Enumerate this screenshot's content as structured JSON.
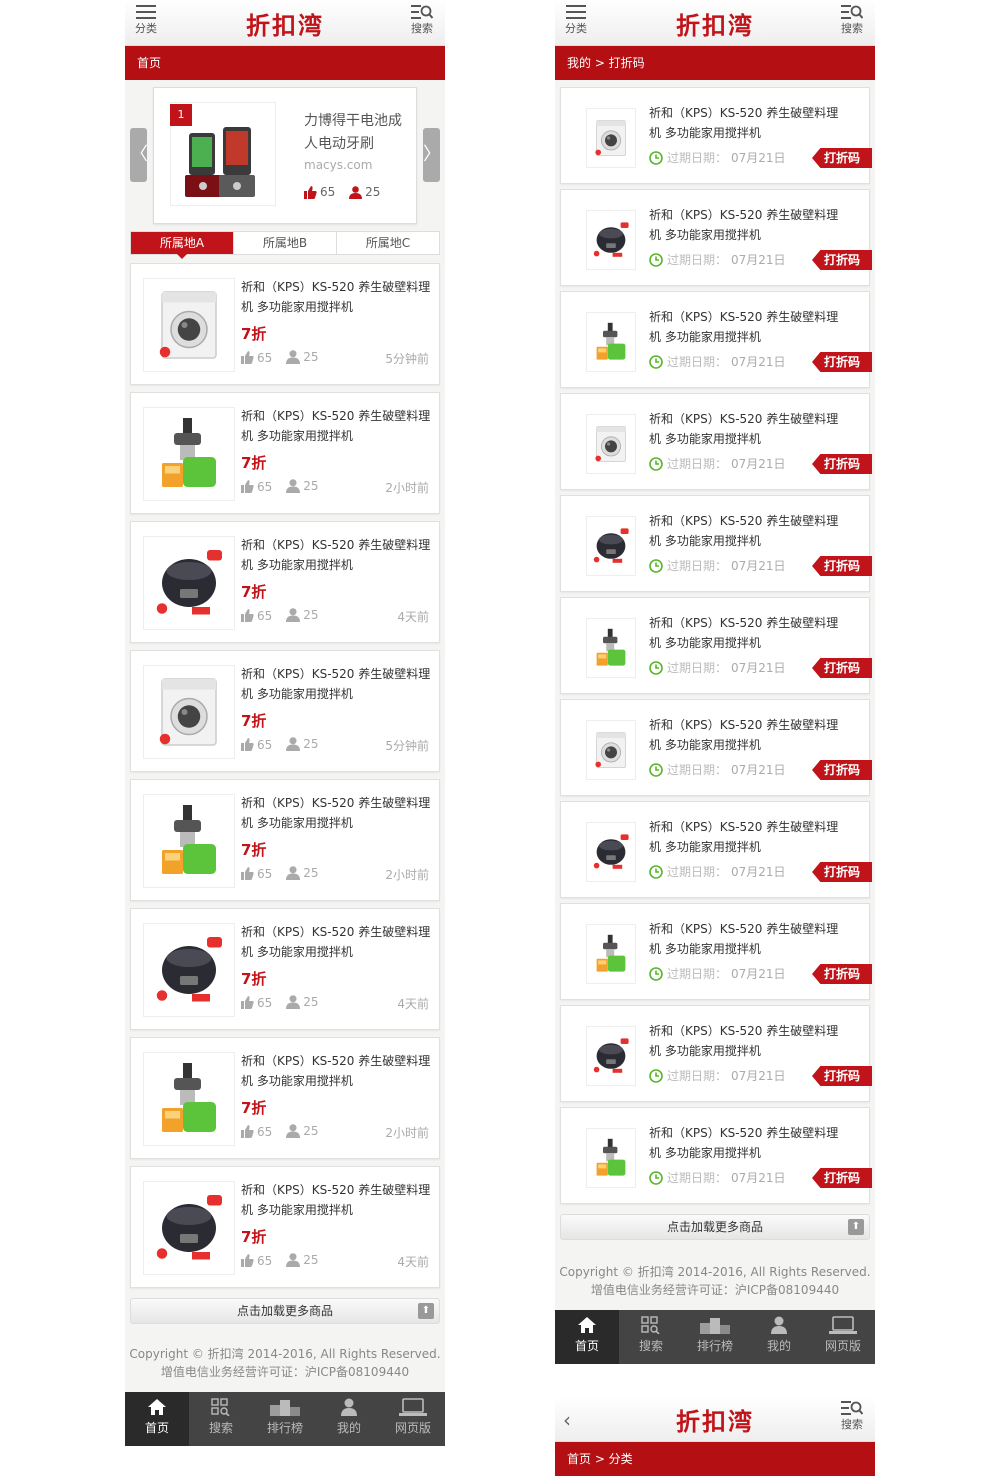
{
  "brand": "折扣湾",
  "topbar": {
    "menu_label": "分类",
    "search_label": "搜索"
  },
  "screen1": {
    "breadcrumb": "首页",
    "slider": {
      "index": "1",
      "title": "力博得干电池成人电动牙刷",
      "source": "macys.com",
      "likes": "65",
      "users": "25"
    },
    "tabs": [
      "所属地A",
      "所属地B",
      "所属地C"
    ],
    "items": [
      {
        "title": "祈和（KPS）KS-520 养生破壁料理机 多功能家用搅拌机",
        "discount": "7折",
        "likes": "65",
        "users": "25",
        "time": "5分钟前",
        "img": "washer"
      },
      {
        "title": "祈和（KPS）KS-520 养生破壁料理机 多功能家用搅拌机",
        "discount": "7折",
        "likes": "65",
        "users": "25",
        "time": "2小时前",
        "img": "juicer"
      },
      {
        "title": "祈和（KPS）KS-520 养生破壁料理机 多功能家用搅拌机",
        "discount": "7折",
        "likes": "65",
        "users": "25",
        "time": "4天前",
        "img": "cooker"
      },
      {
        "title": "祈和（KPS）KS-520 养生破壁料理机 多功能家用搅拌机",
        "discount": "7折",
        "likes": "65",
        "users": "25",
        "time": "5分钟前",
        "img": "washer"
      },
      {
        "title": "祈和（KPS）KS-520 养生破壁料理机 多功能家用搅拌机",
        "discount": "7折",
        "likes": "65",
        "users": "25",
        "time": "2小时前",
        "img": "juicer"
      },
      {
        "title": "祈和（KPS）KS-520 养生破壁料理机 多功能家用搅拌机",
        "discount": "7折",
        "likes": "65",
        "users": "25",
        "time": "4天前",
        "img": "cooker"
      },
      {
        "title": "祈和（KPS）KS-520 养生破壁料理机 多功能家用搅拌机",
        "discount": "7折",
        "likes": "65",
        "users": "25",
        "time": "2小时前",
        "img": "juicer"
      },
      {
        "title": "祈和（KPS）KS-520 养生破壁料理机 多功能家用搅拌机",
        "discount": "7折",
        "likes": "65",
        "users": "25",
        "time": "4天前",
        "img": "cooker"
      }
    ]
  },
  "screen2": {
    "breadcrumb": "我的 > 打折码",
    "expire_label": "过期日期：",
    "code_label": "打折码",
    "items": [
      {
        "title": "祈和（KPS）KS-520 养生破壁料理机 多功能家用搅拌机",
        "expire": "07月21日",
        "img": "washer"
      },
      {
        "title": "祈和（KPS）KS-520 养生破壁料理机 多功能家用搅拌机",
        "expire": "07月21日",
        "img": "cooker"
      },
      {
        "title": "祈和（KPS）KS-520 养生破壁料理机 多功能家用搅拌机",
        "expire": "07月21日",
        "img": "juicer"
      },
      {
        "title": "祈和（KPS）KS-520 养生破壁料理机 多功能家用搅拌机",
        "expire": "07月21日",
        "img": "washer"
      },
      {
        "title": "祈和（KPS）KS-520 养生破壁料理机 多功能家用搅拌机",
        "expire": "07月21日",
        "img": "cooker"
      },
      {
        "title": "祈和（KPS）KS-520 养生破壁料理机 多功能家用搅拌机",
        "expire": "07月21日",
        "img": "juicer"
      },
      {
        "title": "祈和（KPS）KS-520 养生破壁料理机 多功能家用搅拌机",
        "expire": "07月21日",
        "img": "washer"
      },
      {
        "title": "祈和（KPS）KS-520 养生破壁料理机 多功能家用搅拌机",
        "expire": "07月21日",
        "img": "cooker"
      },
      {
        "title": "祈和（KPS）KS-520 养生破壁料理机 多功能家用搅拌机",
        "expire": "07月21日",
        "img": "juicer"
      },
      {
        "title": "祈和（KPS）KS-520 养生破壁料理机 多功能家用搅拌机",
        "expire": "07月21日",
        "img": "cooker"
      },
      {
        "title": "祈和（KPS）KS-520 养生破壁料理机 多功能家用搅拌机",
        "expire": "07月21日",
        "img": "juicer"
      }
    ]
  },
  "screen3": {
    "breadcrumb": "首页 > 分类"
  },
  "load_more": "点击加载更多商品",
  "footer": {
    "copyright": "Copyright © 折扣湾 2014-2016, All Rights Reserved.",
    "icp": "增值电信业务经营许可证：沪ICP备08109440"
  },
  "bottom_nav": [
    {
      "label": "首页",
      "icon": "home-icon"
    },
    {
      "label": "搜索",
      "icon": "grid-search-icon"
    },
    {
      "label": "排行榜",
      "icon": "podium-icon"
    },
    {
      "label": "我的",
      "icon": "user-icon"
    },
    {
      "label": "网页版",
      "icon": "laptop-icon"
    }
  ],
  "colors": {
    "brand_red": "#c0141a",
    "breadcrumb_red": "#b41014",
    "nav_bg": "#444444",
    "clock_green": "#5ab52a"
  }
}
